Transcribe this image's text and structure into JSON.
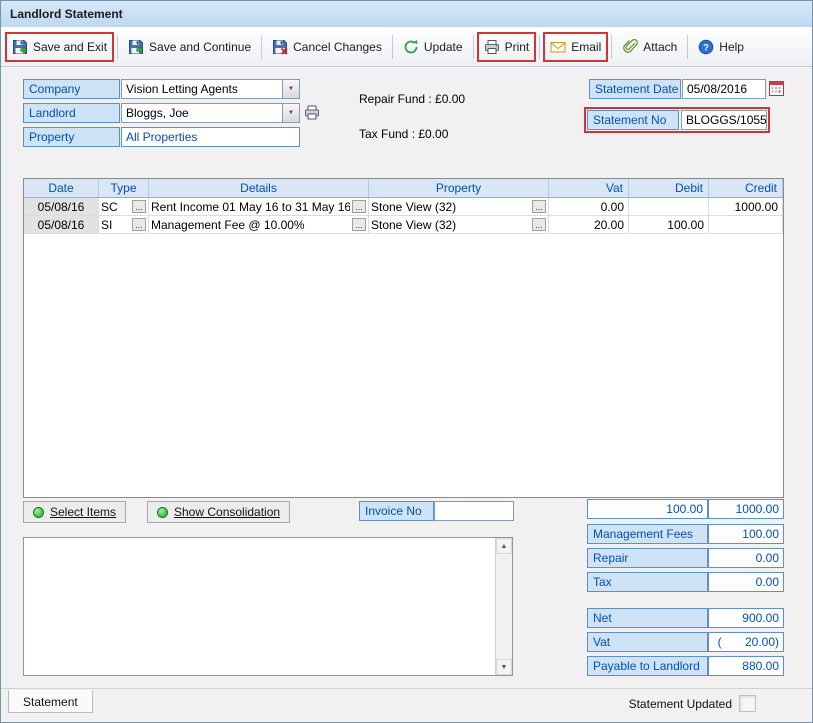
{
  "window": {
    "title": "Landlord Statement"
  },
  "toolbar": {
    "buttons": [
      {
        "label": "Save and Exit",
        "icon": "save-exit-icon",
        "highlighted": true
      },
      {
        "label": "Save and Continue",
        "icon": "save-continue-icon",
        "highlighted": false
      },
      {
        "label": "Cancel Changes",
        "icon": "cancel-changes-icon",
        "highlighted": false
      },
      {
        "label": "Update",
        "icon": "update-icon",
        "highlighted": false
      },
      {
        "label": "Print",
        "icon": "print-icon",
        "highlighted": true
      },
      {
        "label": "Email",
        "icon": "email-icon",
        "highlighted": true
      },
      {
        "label": "Attach",
        "icon": "attach-icon",
        "highlighted": false
      },
      {
        "label": "Help",
        "icon": "help-icon",
        "highlighted": false
      }
    ]
  },
  "form": {
    "company": {
      "label": "Company",
      "value": "Vision Letting Agents"
    },
    "landlord": {
      "label": "Landlord",
      "value": "Bloggs, Joe"
    },
    "property": {
      "label": "Property",
      "value": "All Properties"
    },
    "repair_fund": "Repair Fund : £0.00",
    "tax_fund": "Tax Fund : £0.00",
    "statement_date": {
      "label": "Statement Date",
      "value": "05/08/2016"
    },
    "statement_no": {
      "label": "Statement No",
      "value": "BLOGGS/1055"
    }
  },
  "grid": {
    "ellipsis": "...",
    "columns": [
      "Date",
      "Type",
      "Details",
      "Property",
      "Vat",
      "Debit",
      "Credit"
    ],
    "rows": [
      {
        "date": "05/08/16",
        "type": "SC",
        "details": "Rent Income 01 May 16 to 31 May 16",
        "property": "Stone View (32)",
        "vat": "0.00",
        "debit": "",
        "credit": "1000.00"
      },
      {
        "date": "05/08/16",
        "type": "SI",
        "details": "Management Fee @ 10.00%",
        "property": "Stone View (32)",
        "vat": "20.00",
        "debit": "100.00",
        "credit": ""
      }
    ]
  },
  "actions": {
    "select_items": "Select Items",
    "show_consolidation": "Show Consolidation",
    "invoice_no": {
      "label": "Invoice No",
      "value": ""
    }
  },
  "totals": {
    "debit_total": "100.00",
    "credit_total": "1000.00",
    "fees": [
      {
        "label": "Management Fees",
        "value": "100.00"
      },
      {
        "label": "Repair",
        "value": "0.00"
      },
      {
        "label": "Tax",
        "value": "0.00"
      }
    ],
    "summary": [
      {
        "label": "Net",
        "value": "900.00"
      },
      {
        "label": "Vat",
        "value": "(       20.00)"
      },
      {
        "label": "Payable to Landlord",
        "value": "880.00"
      }
    ]
  },
  "statusbar": {
    "tab": "Statement",
    "updated_label": "Statement Updated"
  },
  "colors": {
    "accent-blue": "#0050b4",
    "chip-bg": "#cfe3f7",
    "chip-border": "#5e8fc9",
    "highlight-red": "#d03434",
    "titlebar-bg": "#bcd8f0",
    "grid-header-bg": "#d8e6f6"
  }
}
